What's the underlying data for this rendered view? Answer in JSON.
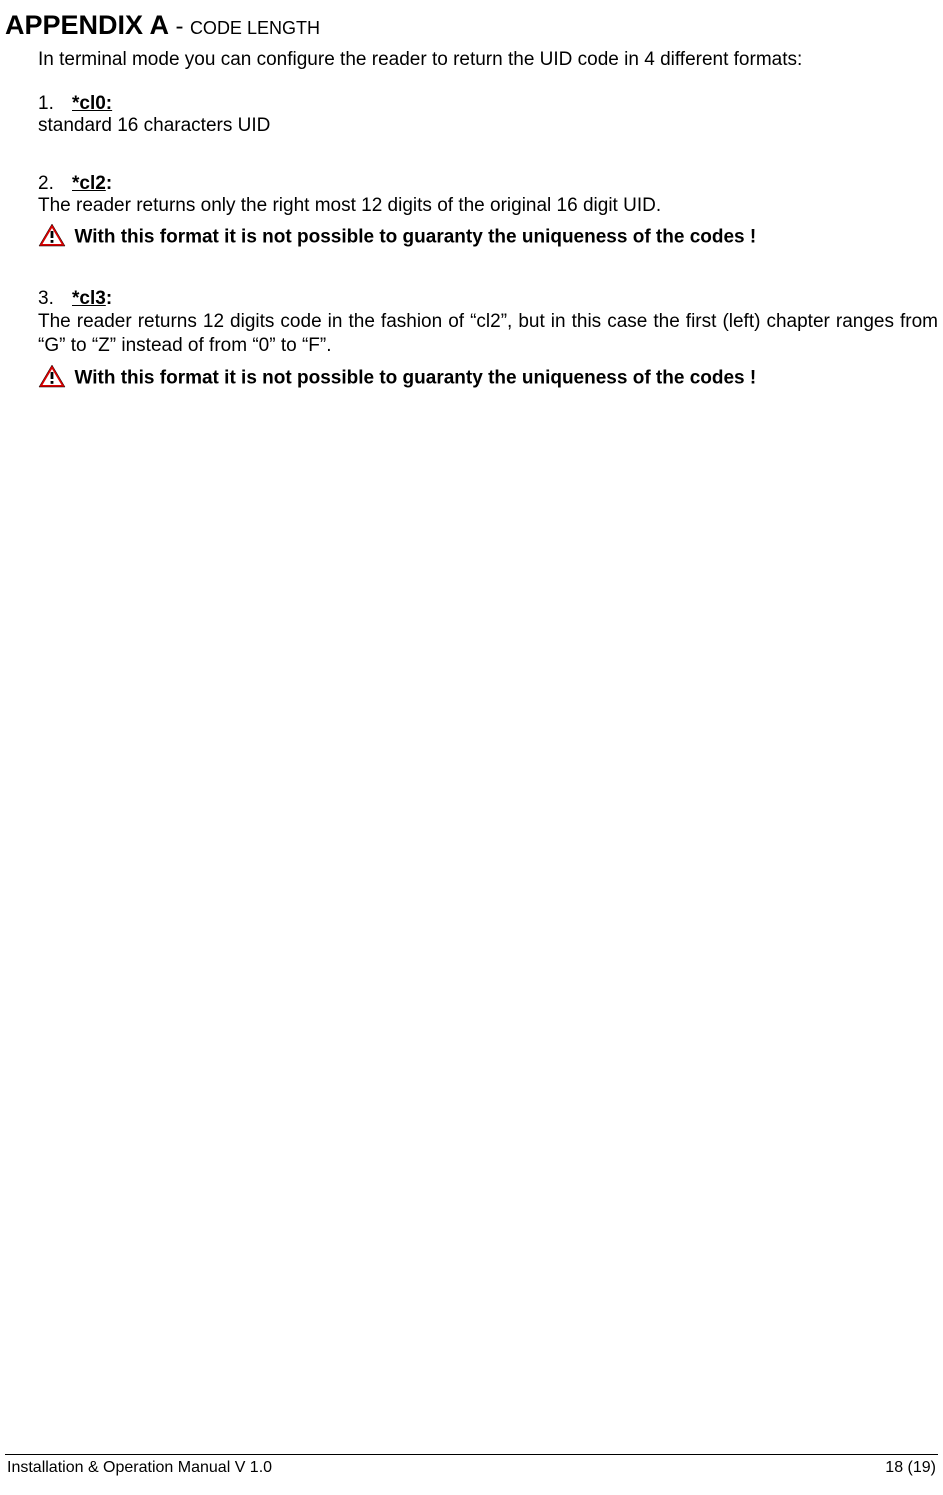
{
  "heading": {
    "main": "APPENDIX A",
    "dash": "-",
    "sub": "CODE LENGTH"
  },
  "intro": "In terminal mode you can configure the reader to return the UID code in 4 different formats:",
  "items": [
    {
      "num": "1.",
      "cmd": "*cl0:",
      "colon": "",
      "body": "standard 16 characters UID",
      "warning": ""
    },
    {
      "num": "2.",
      "cmd": "*cl2",
      "colon": ":",
      "body": "The reader returns only the right most 12 digits of the original 16 digit UID.",
      "warning": "With this format it is not possible to guaranty the uniqueness of the codes !"
    },
    {
      "num": "3.",
      "cmd": "*cl3",
      "colon": ":",
      "body": "The reader returns 12 digits code in the fashion of “cl2”, but in this case the first (left) chapter ranges  from “G” to “Z” instead of from “0” to “F”.",
      "warning": "With this format it is not possible to guaranty the uniqueness of the codes !"
    }
  ],
  "footer": {
    "left": "Installation & Operation Manual V 1.0",
    "right": "18 (19)"
  }
}
